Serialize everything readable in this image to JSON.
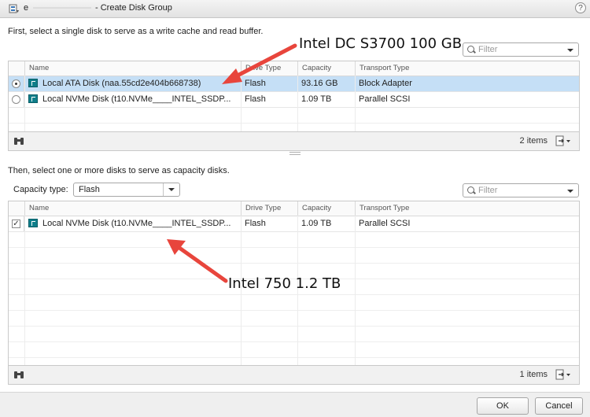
{
  "window": {
    "title_prefix": "e",
    "title": "- Create Disk Group",
    "help": "?"
  },
  "cache_section": {
    "instruction": "First, select a single disk to serve as a write cache and read buffer.",
    "filter_placeholder": "Filter",
    "columns": [
      "Name",
      "Drive Type",
      "Capacity",
      "Transport Type"
    ],
    "rows": [
      {
        "name": "Local ATA Disk (naa.55cd2e404b668738)",
        "drive_type": "Flash",
        "capacity": "93.16 GB",
        "transport": "Block Adapter",
        "selected": true
      },
      {
        "name": "Local NVMe Disk (t10.NVMe____INTEL_SSDP...",
        "drive_type": "Flash",
        "capacity": "1.09 TB",
        "transport": "Parallel SCSI",
        "selected": false
      }
    ],
    "item_count": "2 items"
  },
  "capacity_section": {
    "instruction": "Then, select one or more disks to serve as capacity disks.",
    "capacity_type_label": "Capacity type:",
    "capacity_type_value": "Flash",
    "filter_placeholder": "Filter",
    "columns": [
      "Name",
      "Drive Type",
      "Capacity",
      "Transport Type"
    ],
    "rows": [
      {
        "name": "Local NVMe Disk (t10.NVMe____INTEL_SSDP...",
        "drive_type": "Flash",
        "capacity": "1.09 TB",
        "transport": "Parallel SCSI",
        "checked": true
      }
    ],
    "item_count": "1 items"
  },
  "buttons": {
    "ok": "OK",
    "cancel": "Cancel"
  },
  "annotations": {
    "top": "Intel DC S3700 100 GB",
    "bottom": "Intel 750 1.2 TB",
    "arrow_color": "#e8453c"
  },
  "colors": {
    "selected_row": "#c5dff6",
    "disk_icon": "#0f7e8a"
  }
}
